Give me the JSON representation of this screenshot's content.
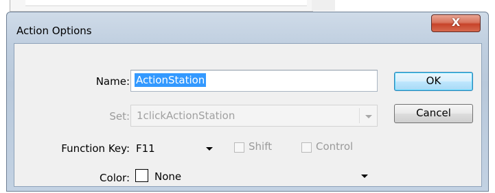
{
  "window": {
    "title": "Action Options",
    "close_glyph": "X"
  },
  "form": {
    "name_label": "Name:",
    "name_value": "ActionStation",
    "set_label": "Set:",
    "set_value": "1clickActionStation",
    "function_key_label": "Function Key:",
    "function_key_value": "F11",
    "shift_label": "Shift",
    "shift_checked": false,
    "control_label": "Control",
    "control_checked": false,
    "color_label": "Color:",
    "color_value": "None"
  },
  "buttons": {
    "ok_label": "OK",
    "cancel_label": "Cancel"
  },
  "colors": {
    "selection": "#3399ff",
    "close_button": "#c7432a",
    "default_button_border": "#3c7fb1"
  }
}
